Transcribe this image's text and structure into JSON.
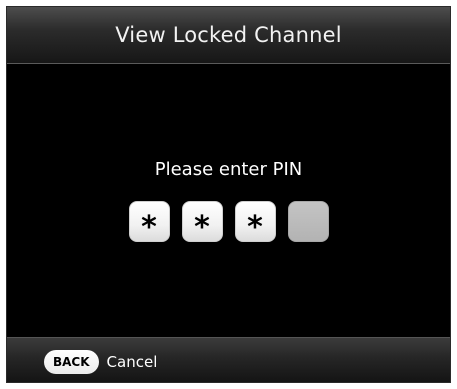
{
  "header": {
    "title": "View Locked Channel"
  },
  "prompt": {
    "text": "Please enter PIN"
  },
  "pin": {
    "digits_entered": 3,
    "total_digits": 4,
    "boxes": [
      {
        "mask": "*",
        "state": "filled"
      },
      {
        "mask": "*",
        "state": "filled"
      },
      {
        "mask": "*",
        "state": "filled"
      },
      {
        "mask": "",
        "state": "empty"
      }
    ]
  },
  "footer": {
    "back_label": "BACK",
    "cancel_label": "Cancel"
  },
  "colors": {
    "background": "#000000",
    "pin_filled": "#f1f1f1",
    "pin_empty": "#b8b8b8",
    "text": "#ffffff"
  }
}
